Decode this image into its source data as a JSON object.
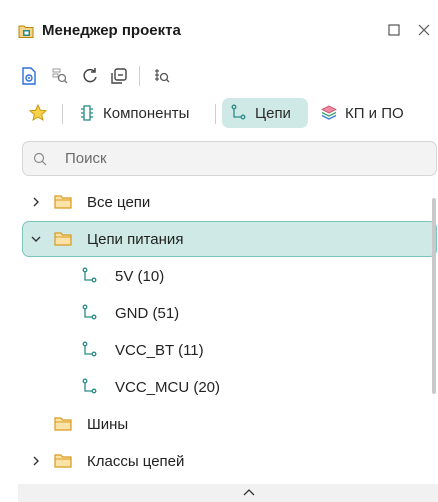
{
  "window": {
    "title": "Менеджер проекта",
    "title_icon": "project-manager-icon",
    "controls": [
      "maximize-icon",
      "close-icon"
    ]
  },
  "toolbar": {
    "icons": [
      "document-view-icon",
      "search-files-icon",
      "refresh-icon",
      "collapse-all-icon",
      "find-component-icon"
    ]
  },
  "tabs": [
    {
      "label": "",
      "icon": "star-icon",
      "active": false
    },
    {
      "label": "Компоненты",
      "icon": "component-icon",
      "active": false
    },
    {
      "label": "Цепи",
      "icon": "net-icon",
      "active": true
    },
    {
      "label": "КП и ПО",
      "icon": "layers-icon",
      "active": false
    }
  ],
  "search": {
    "placeholder": "Поиск",
    "value": ""
  },
  "tree": {
    "items": [
      {
        "label": "Все цепи",
        "type": "folder",
        "expanded": false,
        "has_children": true
      },
      {
        "label": "Цепи питания",
        "type": "folder",
        "expanded": true,
        "has_children": true,
        "selected": true
      },
      {
        "label": "5V (10)",
        "type": "net"
      },
      {
        "label": "GND (51)",
        "type": "net"
      },
      {
        "label": "VCC_BT (11)",
        "type": "net"
      },
      {
        "label": "VCC_MCU (20)",
        "type": "net"
      },
      {
        "label": "Шины",
        "type": "folder",
        "has_children": false
      },
      {
        "label": "Классы цепей",
        "type": "folder",
        "expanded": false,
        "has_children": true
      }
    ]
  },
  "colors": {
    "accent": "#cfe9e6",
    "accent_border": "#7bc5bc",
    "folder": "#e6a437",
    "net_icon": "#2a8c86"
  }
}
